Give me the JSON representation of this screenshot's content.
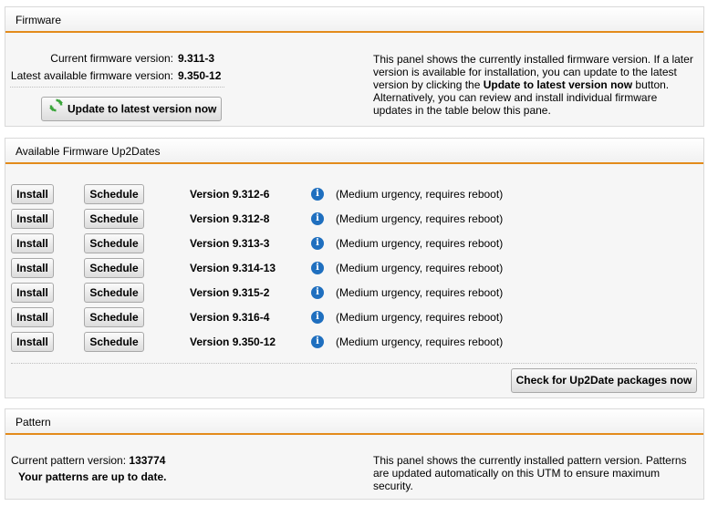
{
  "firmware": {
    "title": "Firmware",
    "current_label": "Current firmware version:",
    "current_value": "9.311-3",
    "latest_label": "Latest available firmware version:",
    "latest_value": "9.350-12",
    "update_button": "Update to latest version now",
    "desc_1": "This panel shows the currently installed firmware version. If a later version is available for installation, you can update to the latest version by clicking the ",
    "desc_bold": "Update to latest version now",
    "desc_2": " button. Alternatively, you can review and install individual firmware updates in the table below this pane."
  },
  "up2dates": {
    "title": "Available Firmware Up2Dates",
    "install_label": "Install",
    "schedule_label": "Schedule",
    "rows": [
      {
        "version": "Version 9.312-6",
        "note": "(Medium urgency, requires reboot)"
      },
      {
        "version": "Version 9.312-8",
        "note": "(Medium urgency, requires reboot)"
      },
      {
        "version": "Version 9.313-3",
        "note": "(Medium urgency, requires reboot)"
      },
      {
        "version": "Version 9.314-13",
        "note": "(Medium urgency, requires reboot)"
      },
      {
        "version": "Version 9.315-2",
        "note": "(Medium urgency, requires reboot)"
      },
      {
        "version": "Version 9.316-4",
        "note": "(Medium urgency, requires reboot)"
      },
      {
        "version": "Version 9.350-12",
        "note": "(Medium urgency, requires reboot)"
      }
    ],
    "check_button": "Check for Up2Date packages now"
  },
  "pattern": {
    "title": "Pattern",
    "current_label": "Current pattern version:",
    "current_value": "133774",
    "status": "Your patterns are up to date.",
    "desc": "This panel shows the currently installed pattern version. Patterns are updated automatically on this UTM to ensure maximum security."
  },
  "colors": {
    "accent": "#e38b1b",
    "info_icon": "#1f6fbf",
    "refresh_icon": "#3aa53a"
  }
}
